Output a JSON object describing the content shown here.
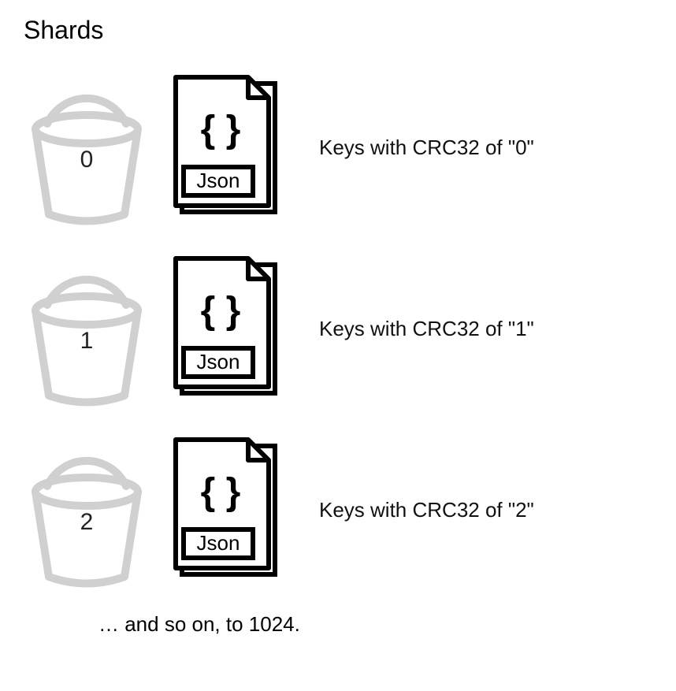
{
  "title": "Shards",
  "rows": [
    {
      "bucket_label": "0",
      "json_label": "Json",
      "description": "Keys with CRC32 of \"0\""
    },
    {
      "bucket_label": "1",
      "json_label": "Json",
      "description": "Keys with CRC32 of \"1\""
    },
    {
      "bucket_label": "2",
      "json_label": "Json",
      "description": "Keys with CRC32 of \"2\""
    }
  ],
  "footer": "… and so on, to 1024."
}
